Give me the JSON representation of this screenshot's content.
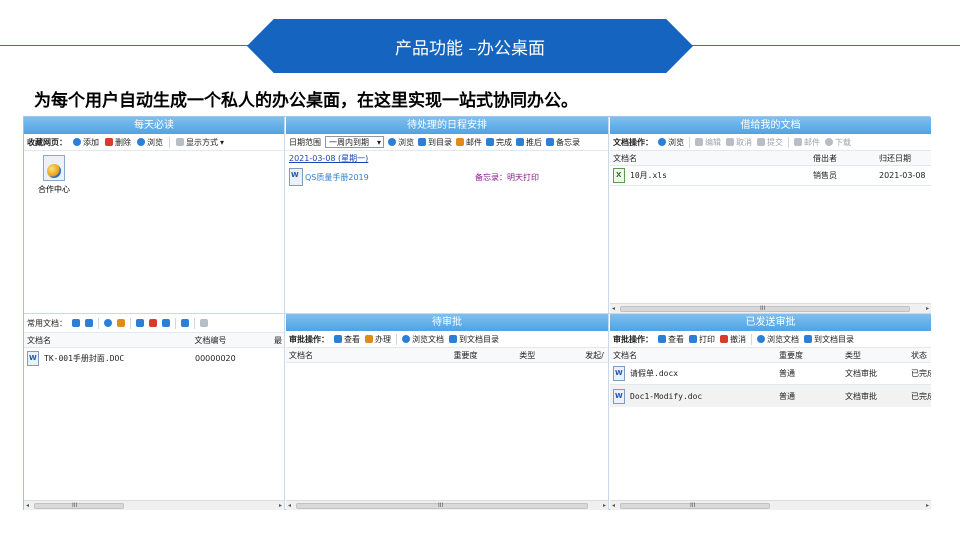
{
  "slide": {
    "banner_title": "产品功能 –办公桌面",
    "subtitle": "为每个用户自动生成一个私人的办公桌面，在这里实现一站式协同办公。"
  },
  "panels": {
    "daily": {
      "title": "每天必读",
      "toolbar_label": "收藏网页：",
      "buttons": [
        "添加",
        "删除",
        "浏览",
        "显示方式"
      ],
      "shortcut_label": "合作中心"
    },
    "schedule": {
      "title": "待处理的日程安排",
      "date_label": "日期范围",
      "date_select": "一周内到期",
      "buttons": [
        "浏览",
        "到目录",
        "邮件",
        "完成",
        "推后",
        "备忘录"
      ],
      "date_heading": "2021-03-08 (星期一)",
      "item_name": "QS质量手册2019",
      "item_memo": "备忘录：明天打印"
    },
    "lent": {
      "title": "借给我的文档",
      "toolbar_label": "文档操作：",
      "buttons": [
        "浏览",
        "编辑",
        "取消",
        "提交",
        "邮件",
        "下载"
      ],
      "columns": [
        "文档名",
        "借出者",
        "归还日期"
      ],
      "rows": [
        {
          "name": "10月.xls",
          "lender": "销售员",
          "date": "2021-03-08"
        }
      ]
    },
    "common": {
      "toolbar_label": "常用文档：",
      "columns": [
        "文档名",
        "文档编号",
        "最"
      ],
      "rows": [
        {
          "name": "TK-001手册封面.DOC",
          "number": "00000020"
        }
      ]
    },
    "pending": {
      "title": "待审批",
      "toolbar_label": "审批操作：",
      "buttons": [
        "查看",
        "办理",
        "浏览文档",
        "到文档目录"
      ],
      "columns": [
        "文档名",
        "重要度",
        "类型",
        "发起/"
      ]
    },
    "sent": {
      "title": "已发送审批",
      "toolbar_label": "审批操作：",
      "buttons": [
        "查看",
        "打印",
        "撤消",
        "浏览文档",
        "到文档目录"
      ],
      "columns": [
        "文档名",
        "重要度",
        "类型",
        "状态"
      ],
      "rows": [
        {
          "name": "请假单.docx",
          "importance": "普通",
          "type": "文档审批",
          "status": "已完成"
        },
        {
          "name": "Doc1-Modify.doc",
          "importance": "普通",
          "type": "文档审批",
          "status": "已完成"
        }
      ]
    }
  },
  "icons": {
    "add": "plus-circle-icon",
    "delete": "trash-icon",
    "browse": "eye-icon",
    "display_mode": "list-icon",
    "mail": "envelope-icon",
    "complete": "check-doc-icon",
    "postpone": "calendar-icon",
    "memo": "memo-icon"
  },
  "colors": {
    "banner": "#1565c0",
    "panel_title": "#4fa3e3",
    "link": "#1a44b8",
    "memo_text": "#8b1a8b"
  },
  "scrollbar_glyph": "III"
}
